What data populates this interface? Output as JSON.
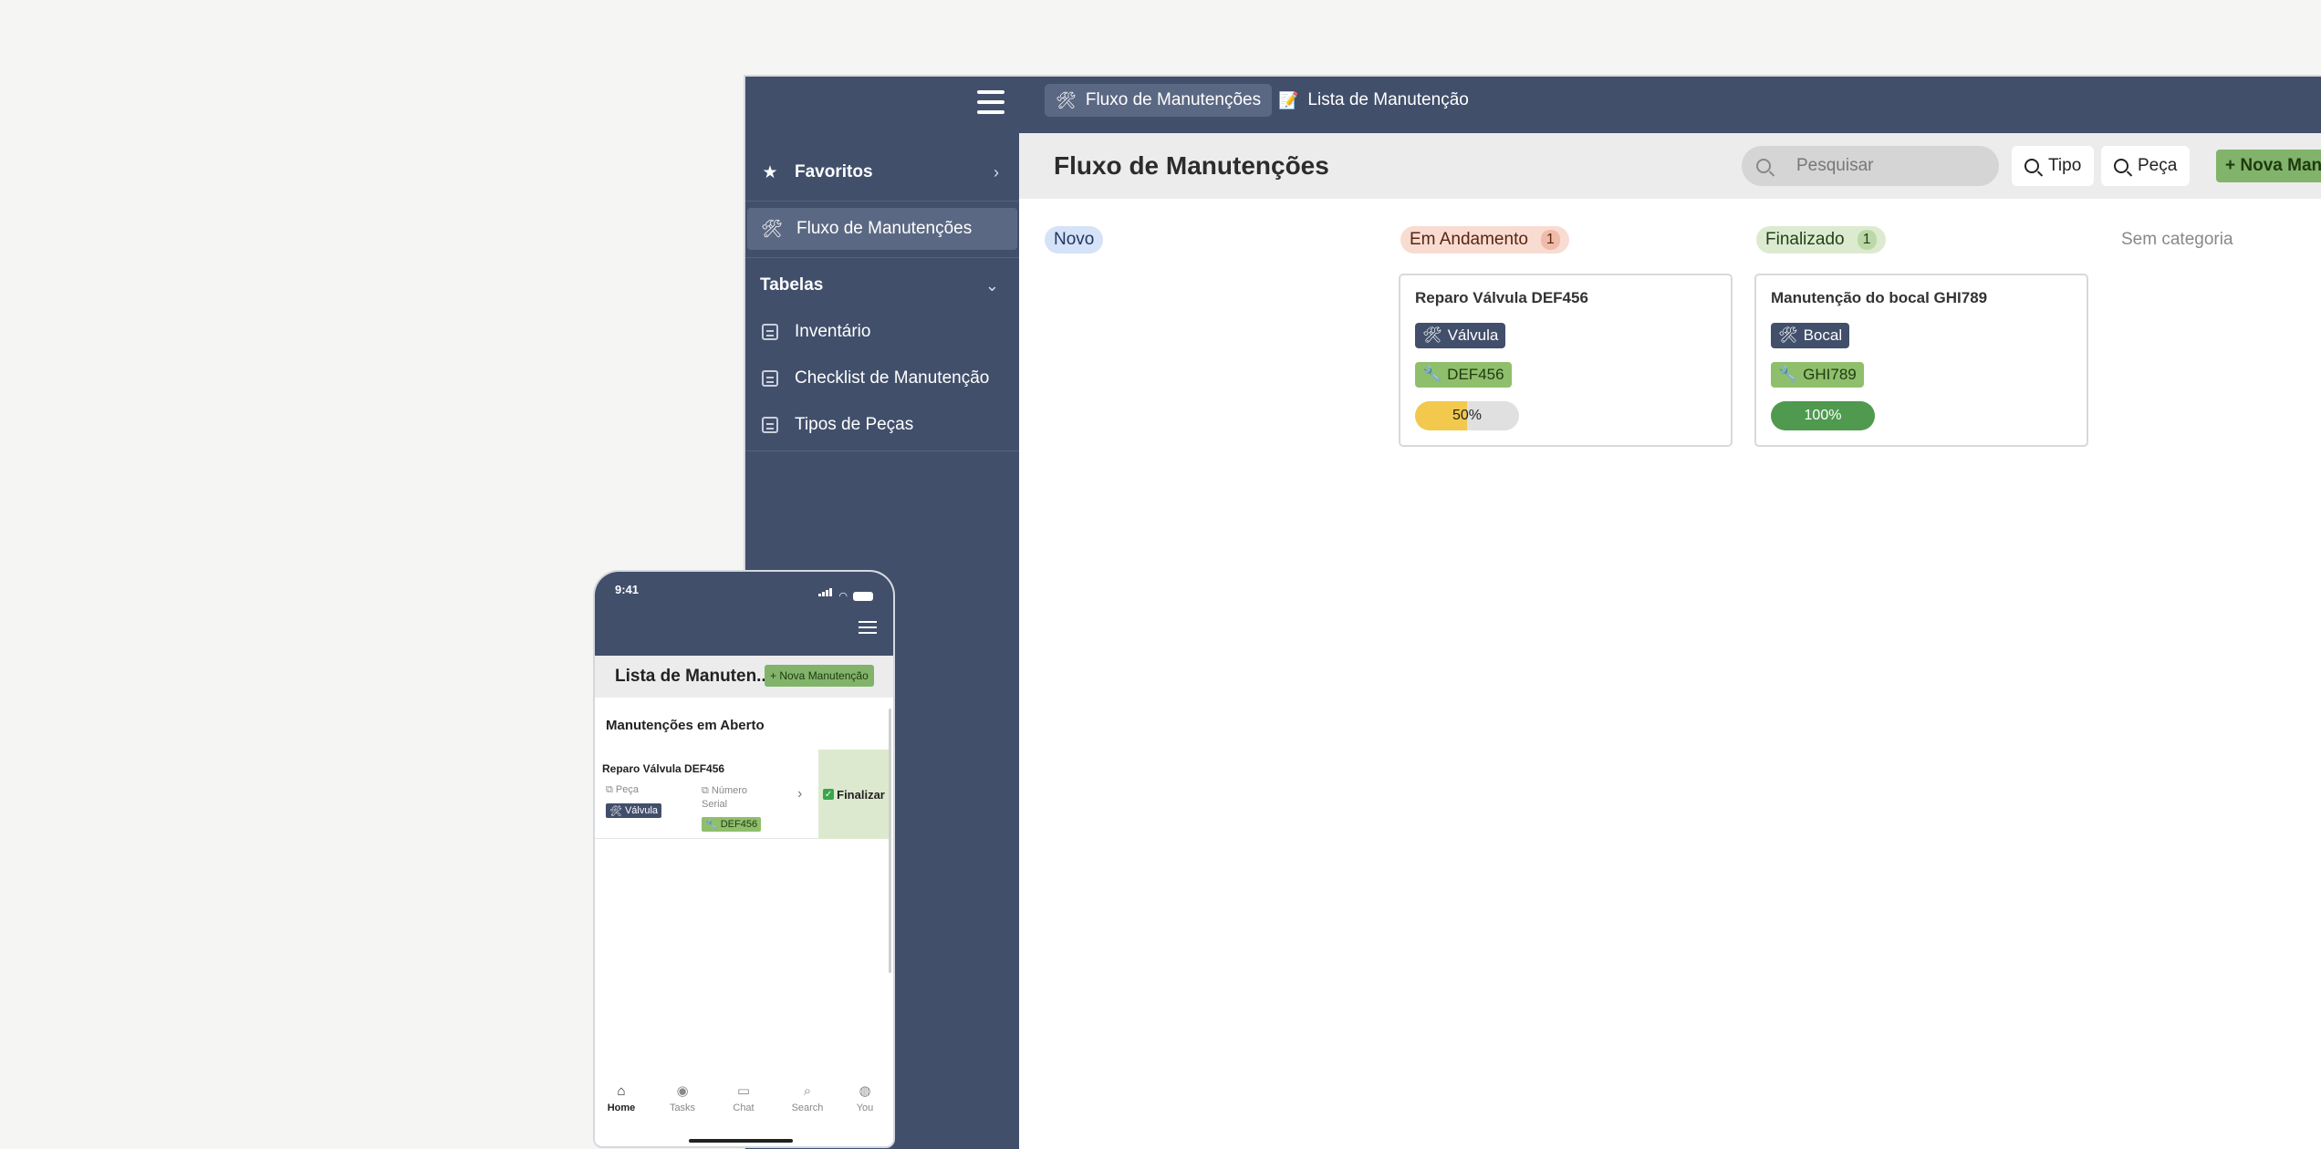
{
  "desktop": {
    "tabs": [
      {
        "icon": "🛠",
        "label": "Fluxo de Manutenções"
      },
      {
        "icon": "📝",
        "label": "Lista de Manutenção"
      }
    ],
    "sidebar": {
      "favorites": "Favoritos",
      "active_item": "Fluxo de Manutenções",
      "tables_header": "Tabelas",
      "tables": [
        "Inventário",
        "Checklist de Manutenção",
        "Tipos de Peças"
      ]
    },
    "page_title": "Fluxo de Manutenções",
    "search_placeholder": "Pesquisar",
    "filters": {
      "tipo": "Tipo",
      "peca": "Peça"
    },
    "new_button": "+ Nova Man",
    "columns": [
      {
        "label": "Novo",
        "count": ""
      },
      {
        "label": "Em Andamento",
        "count": "1"
      },
      {
        "label": "Finalizado",
        "count": "1"
      },
      {
        "label": "Sem categoria",
        "count": ""
      }
    ],
    "cards": [
      {
        "title": "Reparo Válvula DEF456",
        "part": "Válvula",
        "serial": "DEF456",
        "progress_label": "50%",
        "progress": 0.5,
        "progress_color": "#f2c94c"
      },
      {
        "title": "Manutenção do bocal GHI789",
        "part": "Bocal",
        "serial": "GHI789",
        "progress_label": "100%",
        "progress": 1.0,
        "progress_color": "#4f9a4f"
      }
    ]
  },
  "mobile": {
    "time": "9:41",
    "title": "Lista de Manuten...",
    "new_button": "+ Nova Manutenção",
    "section": "Manutenções em Aberto",
    "row": {
      "title": "Reparo Válvula DEF456",
      "part_label": "Peça",
      "part": "Válvula",
      "serial_label_1": "Número",
      "serial_label_2": "Serial",
      "serial": "DEF456",
      "finish": "Finalizar"
    },
    "nav": [
      "Home",
      "Tasks",
      "Chat",
      "Search",
      "You"
    ]
  },
  "colors": {
    "brand_dark": "#414f6b",
    "accent_green": "#82b36a",
    "progress_half": "#f2c94c",
    "progress_full": "#4f9a4f"
  }
}
